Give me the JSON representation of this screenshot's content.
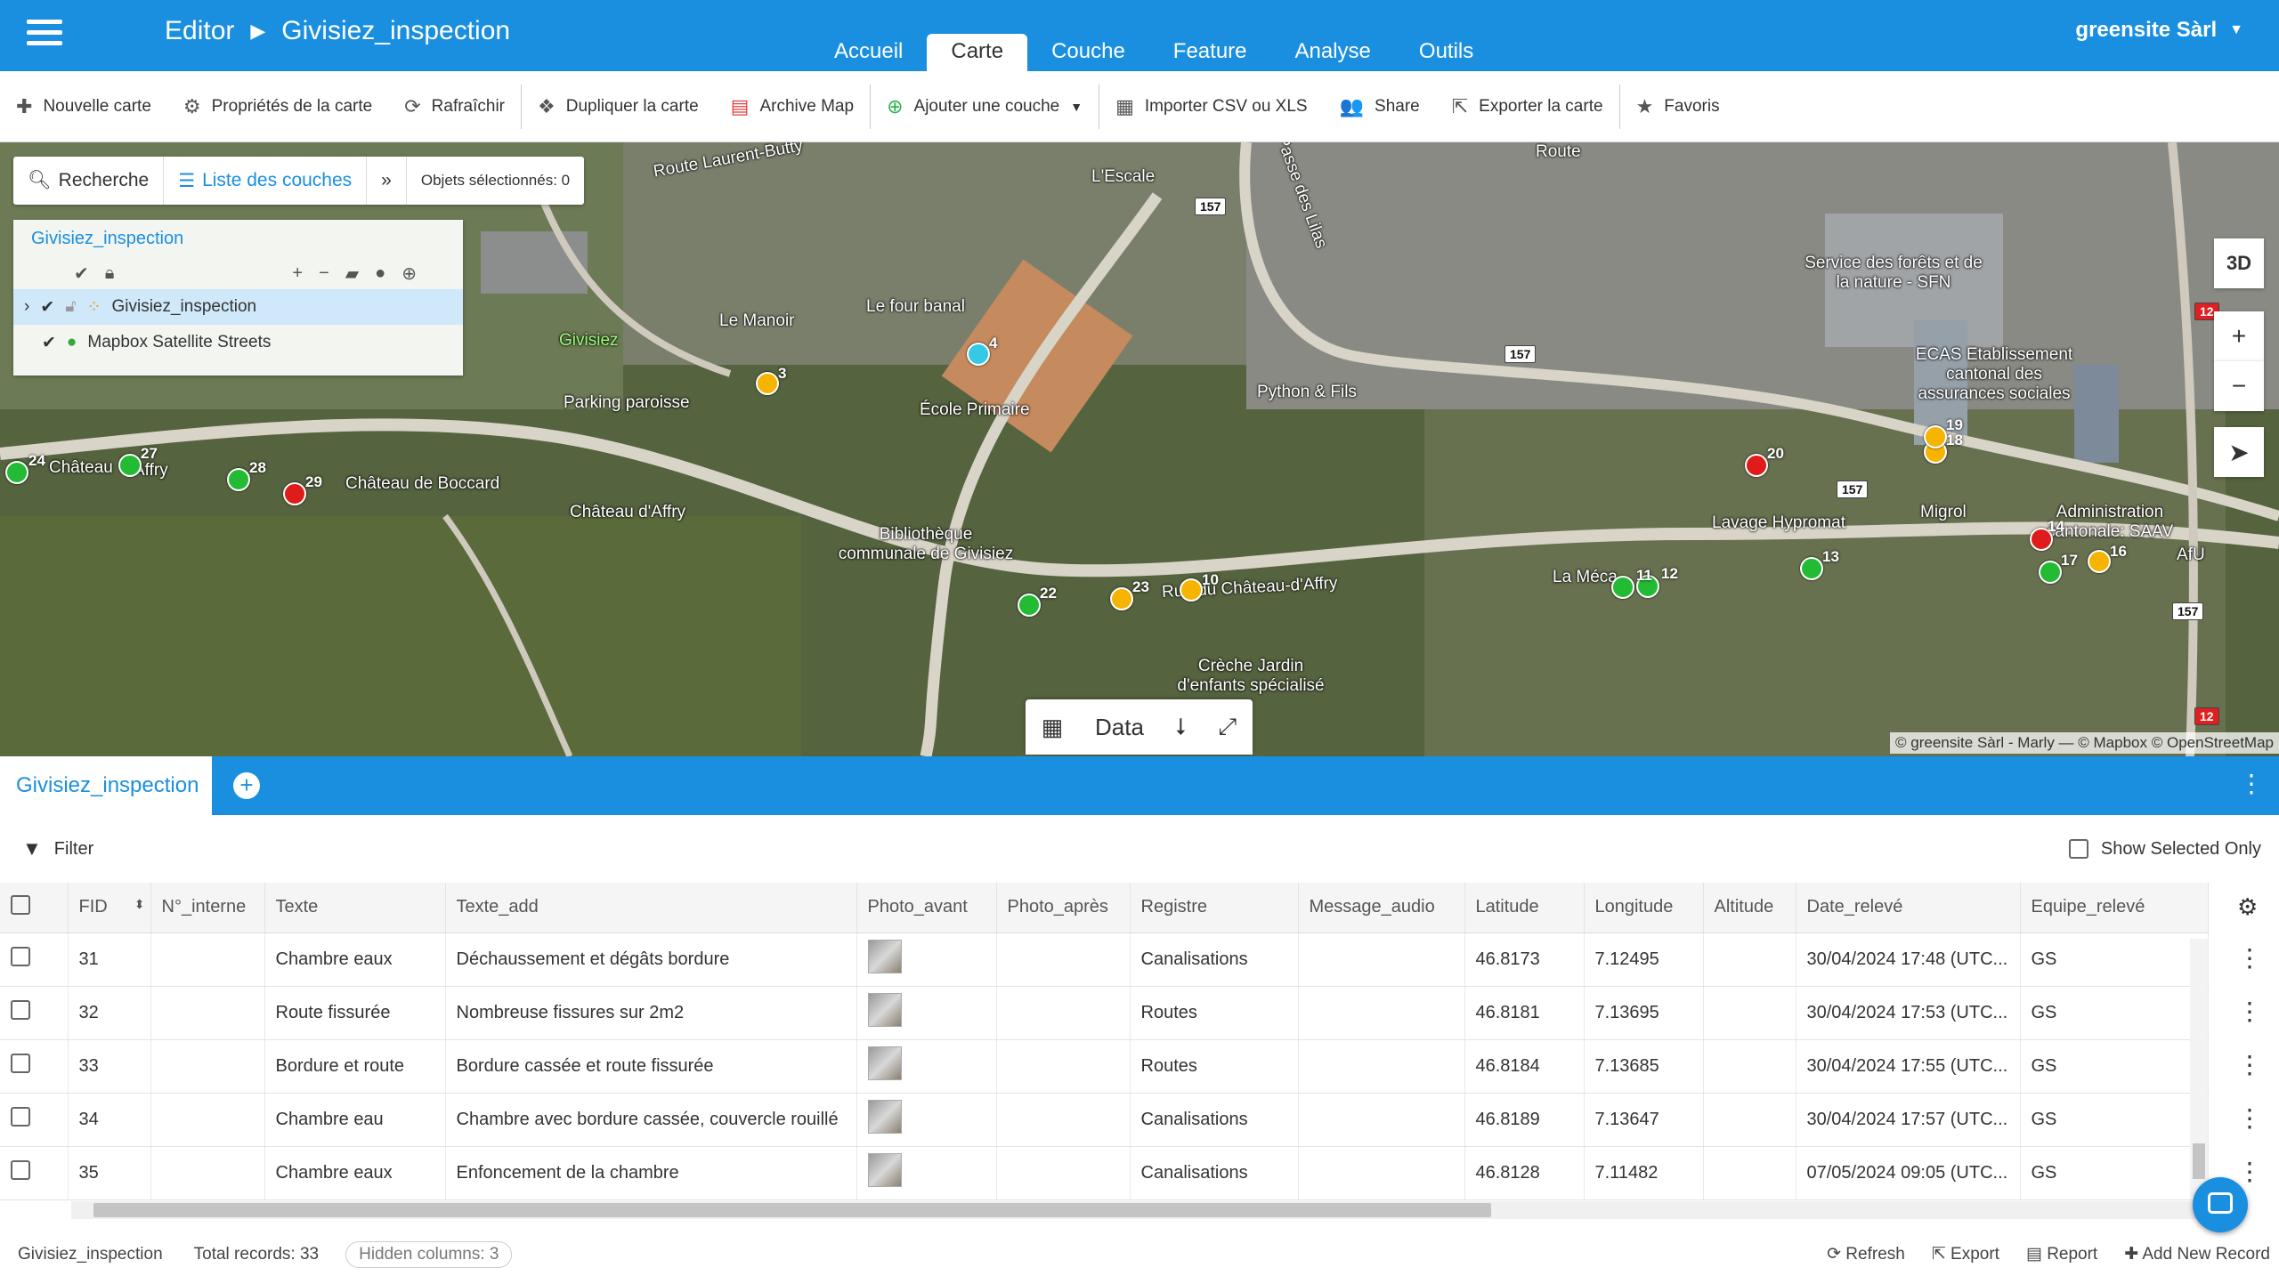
{
  "topbar": {
    "app": "Editor",
    "project": "Givisiez_inspection",
    "tabs": [
      "Accueil",
      "Carte",
      "Couche",
      "Feature",
      "Analyse",
      "Outils"
    ],
    "active_tab": "Carte",
    "user": "greensite Sàrl"
  },
  "toolbar": {
    "new_map": "Nouvelle carte",
    "map_props": "Propriétés de la carte",
    "refresh": "Rafraîchir",
    "duplicate": "Dupliquer la carte",
    "archive": "Archive Map",
    "add_layer": "Ajouter une couche",
    "import": "Importer CSV ou XLS",
    "share": "Share",
    "export": "Exporter la carte",
    "favorites": "Favoris"
  },
  "map_search": {
    "search": "Recherche",
    "layers": "Liste des couches",
    "selected": "Objets sélectionnés: 0"
  },
  "layer_panel": {
    "title": "Givisiez_inspection",
    "layers": [
      "Givisiez_inspection",
      "Mapbox Satellite Streets"
    ]
  },
  "map": {
    "labels": [
      "Route Laurent-Butty",
      "L'Escale",
      "Passe des Lilas",
      "Route",
      "Service des forêts et de la nature - SFN",
      "ECAS Etablissement cantonal des assurances sociales",
      "Le Manoir",
      "Le four banal",
      "Givisiez",
      "Parking paroisse",
      "École Primaire",
      "Python & Fils",
      "Château de Boccard",
      "Château d'Affry",
      "Bibliothèque communale de Givisiez",
      "Lavage Hypromat",
      "Migrol",
      "Administration cantonale: SAAV",
      "Crèche Jardin d'enfants spécialisé",
      "Rue du Château-d'Affry",
      "La Méca",
      "Château",
      "Affry",
      "AfU"
    ],
    "road_numbers": [
      "157",
      "157",
      "157",
      "157",
      "12",
      "12"
    ],
    "btn_3d": "3D",
    "attribution": "© greensite Sàrl - Marly — © Mapbox © OpenStreetMap",
    "data_button": "Data",
    "points": [
      {
        "n": "3",
        "color": "#f5b400"
      },
      {
        "n": "4",
        "color": "#35c9e6"
      },
      {
        "n": "10",
        "color": "#f5b400"
      },
      {
        "n": "11",
        "color": "#22bb33"
      },
      {
        "n": "12",
        "color": "#22bb33"
      },
      {
        "n": "13",
        "color": "#22bb33"
      },
      {
        "n": "14",
        "color": "#e01b1b"
      },
      {
        "n": "16",
        "color": "#f5b400"
      },
      {
        "n": "17",
        "color": "#22bb33"
      },
      {
        "n": "18",
        "color": "#f5b400"
      },
      {
        "n": "19",
        "color": "#f5b400"
      },
      {
        "n": "20",
        "color": "#e01b1b"
      },
      {
        "n": "22",
        "color": "#22bb33"
      },
      {
        "n": "23",
        "color": "#f5b400"
      },
      {
        "n": "24",
        "color": "#22bb33"
      },
      {
        "n": "27",
        "color": "#22bb33"
      },
      {
        "n": "28",
        "color": "#22bb33"
      },
      {
        "n": "29",
        "color": "#e01b1b"
      }
    ]
  },
  "data_panel": {
    "tab": "Givisiez_inspection",
    "filter": "Filter",
    "show_selected": "Show Selected Only",
    "columns": [
      "FID",
      "N°_interne",
      "Texte",
      "Texte_add",
      "Photo_avant",
      "Photo_après",
      "Registre",
      "Message_audio",
      "Latitude",
      "Longitude",
      "Altitude",
      "Date_relevé",
      "Equipe_relevé"
    ],
    "rows": [
      {
        "fid": "31",
        "num": "",
        "texte": "Chambre eaux",
        "texte_add": "Déchaussement et dégâts bordure",
        "registre": "Canalisations",
        "lat": "46.8173",
        "lon": "7.12495",
        "date": "30/04/2024 17:48 (UTC...",
        "equipe": "GS"
      },
      {
        "fid": "32",
        "num": "",
        "texte": "Route fissurée",
        "texte_add": "Nombreuse fissures sur 2m2",
        "registre": "Routes",
        "lat": "46.8181",
        "lon": "7.13695",
        "date": "30/04/2024 17:53 (UTC...",
        "equipe": "GS"
      },
      {
        "fid": "33",
        "num": "",
        "texte": "Bordure et route",
        "texte_add": "Bordure cassée et route fissurée",
        "registre": "Routes",
        "lat": "46.8184",
        "lon": "7.13685",
        "date": "30/04/2024 17:55 (UTC...",
        "equipe": "GS"
      },
      {
        "fid": "34",
        "num": "",
        "texte": "Chambre eau",
        "texte_add": "Chambre avec bordure cassée, couvercle rouillé",
        "registre": "Canalisations",
        "lat": "46.8189",
        "lon": "7.13647",
        "date": "30/04/2024 17:57 (UTC...",
        "equipe": "GS"
      },
      {
        "fid": "35",
        "num": "",
        "texte": "Chambre eaux",
        "texte_add": "Enfoncement de la chambre",
        "registre": "Canalisations",
        "lat": "46.8128",
        "lon": "7.11482",
        "date": "07/05/2024 09:05 (UTC...",
        "equipe": "GS"
      }
    ]
  },
  "footer": {
    "layer": "Givisiez_inspection",
    "total": "Total records: 33",
    "hidden": "Hidden columns: 3",
    "refresh": "Refresh",
    "export": "Export",
    "report": "Report",
    "add": "Add New Record"
  }
}
